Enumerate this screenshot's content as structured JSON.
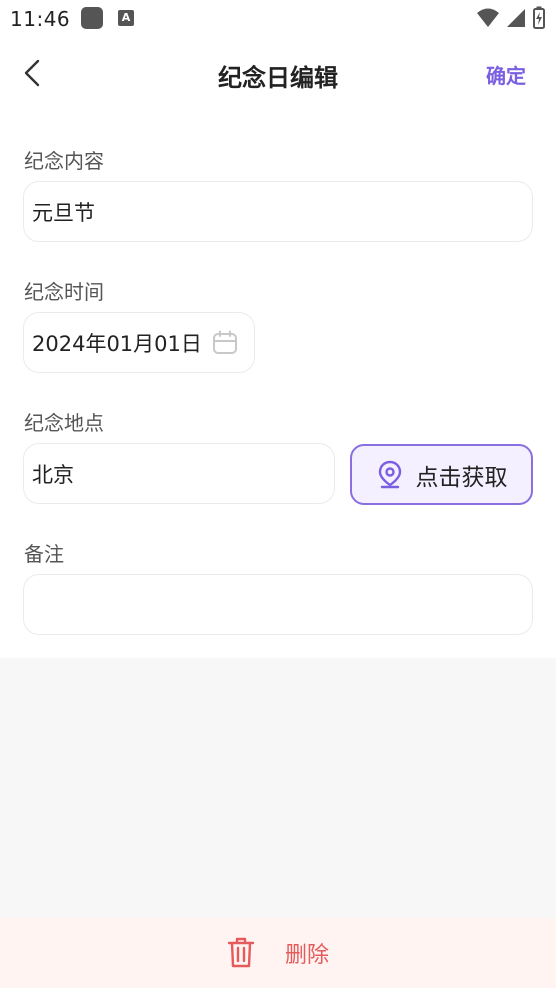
{
  "status_bar": {
    "time": "11:46",
    "app_icon_letter": "A"
  },
  "header": {
    "title": "纪念日编辑",
    "confirm_label": "确定",
    "back_icon": "chevron-left-icon"
  },
  "form": {
    "content": {
      "label": "纪念内容",
      "value": "元旦节"
    },
    "time": {
      "label": "纪念时间",
      "value": "2024年01月01日",
      "icon": "calendar-icon"
    },
    "location": {
      "label": "纪念地点",
      "value": "北京",
      "fetch_label": "点击获取",
      "fetch_icon": "location-pin-icon"
    },
    "note": {
      "label": "备注",
      "value": ""
    }
  },
  "footer": {
    "delete_label": "删除",
    "delete_icon": "trash-icon"
  },
  "colors": {
    "accent": "#7a5fe0",
    "danger": "#e55a5a",
    "danger_bg": "#fff4f2",
    "fetch_bg": "#f5f0ff"
  }
}
